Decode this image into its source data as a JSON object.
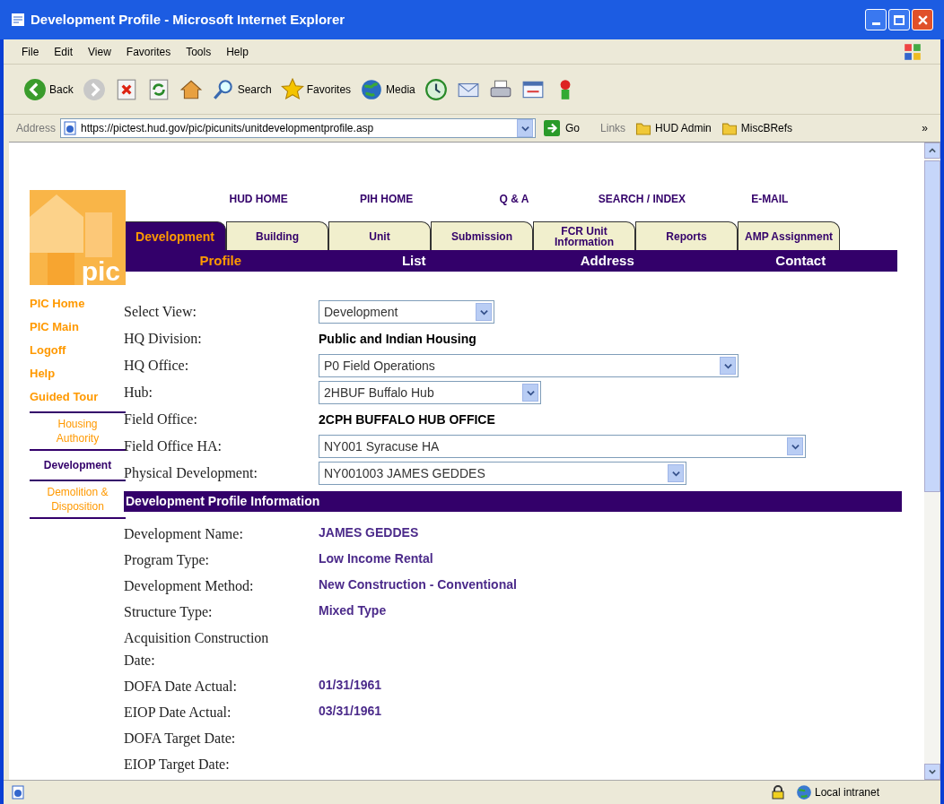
{
  "window": {
    "title": "Development Profile - Microsoft Internet Explorer"
  },
  "menu_bar": [
    "File",
    "Edit",
    "View",
    "Favorites",
    "Tools",
    "Help"
  ],
  "toolbar": [
    {
      "kind": "back",
      "label": "Back"
    },
    {
      "kind": "forward"
    },
    {
      "kind": "stop"
    },
    {
      "kind": "refresh"
    },
    {
      "kind": "home"
    },
    {
      "kind": "search",
      "label": "Search"
    },
    {
      "kind": "favorites",
      "label": "Favorites"
    },
    {
      "kind": "media",
      "label": "Media"
    },
    {
      "kind": "history"
    },
    {
      "kind": "mail"
    },
    {
      "kind": "print"
    },
    {
      "kind": "edit"
    },
    {
      "kind": "messenger"
    }
  ],
  "address_bar": {
    "label": "Address",
    "url": "https://pictest.hud.gov/pic/picunits/unitdevelopmentprofile.asp",
    "go": "Go",
    "links_label": "Links",
    "links": [
      "HUD Admin",
      "MiscBRefs"
    ],
    "more": "»"
  },
  "page": {
    "logo_text": "pic",
    "top_links": [
      "HUD HOME",
      "PIH HOME",
      "Q & A",
      "SEARCH / INDEX",
      "E-MAIL"
    ],
    "tabs": [
      {
        "label": "Development",
        "selected": true
      },
      {
        "label": "Building",
        "selected": false
      },
      {
        "label": "Unit",
        "selected": false
      },
      {
        "label": "Submission",
        "selected": false
      },
      {
        "label": "FCR Unit Information",
        "selected": false
      },
      {
        "label": "Reports",
        "selected": false
      },
      {
        "label": "AMP Assignment",
        "selected": false
      }
    ],
    "sub_tabs": [
      {
        "label": "Profile",
        "selected": true
      },
      {
        "label": "List",
        "selected": false
      },
      {
        "label": "Address",
        "selected": false
      },
      {
        "label": "Contact",
        "selected": false
      }
    ],
    "side_links": [
      "PIC Home",
      "PIC Main",
      "Logoff",
      "Help",
      "Guided Tour"
    ],
    "side_sections": [
      {
        "label": "Housing Authority",
        "selected": false
      },
      {
        "label": "Development",
        "selected": true
      },
      {
        "label": "Demolition & Disposition",
        "selected": false
      }
    ],
    "form": [
      {
        "label": "Select View:",
        "kind": "select",
        "value": "Development"
      },
      {
        "label": "HQ Division:",
        "kind": "text",
        "value": "Public and Indian Housing"
      },
      {
        "label": "HQ Office:",
        "kind": "select",
        "value": "P0 Field Operations"
      },
      {
        "label": "Hub:",
        "kind": "select",
        "value": "2HBUF Buffalo Hub"
      },
      {
        "label": "Field Office:",
        "kind": "text",
        "value": "2CPH BUFFALO HUB OFFICE"
      },
      {
        "label": "Field Office HA:",
        "kind": "select",
        "value": "NY001 Syracuse HA"
      },
      {
        "label": "Physical Development:",
        "kind": "select",
        "value": "NY001003 JAMES GEDDES"
      }
    ],
    "section_title": "Development Profile Information",
    "profile": [
      {
        "label": "Development Name:",
        "value": "JAMES GEDDES"
      },
      {
        "label": "Program Type:",
        "value": "Low Income Rental"
      },
      {
        "label": "Development Method:",
        "value": "New Construction - Conventional"
      },
      {
        "label": "Structure Type:",
        "value": "Mixed Type"
      },
      {
        "label": "Acquisition Construction Date:"
      },
      {
        "label": "DOFA Date Actual:",
        "value": "01/31/1961"
      },
      {
        "label": "EIOP Date Actual:",
        "value": "03/31/1961"
      },
      {
        "label": "DOFA Target Date:"
      },
      {
        "label": "EIOP Target Date:"
      }
    ]
  },
  "status_bar": {
    "zone": "Local intranet"
  }
}
